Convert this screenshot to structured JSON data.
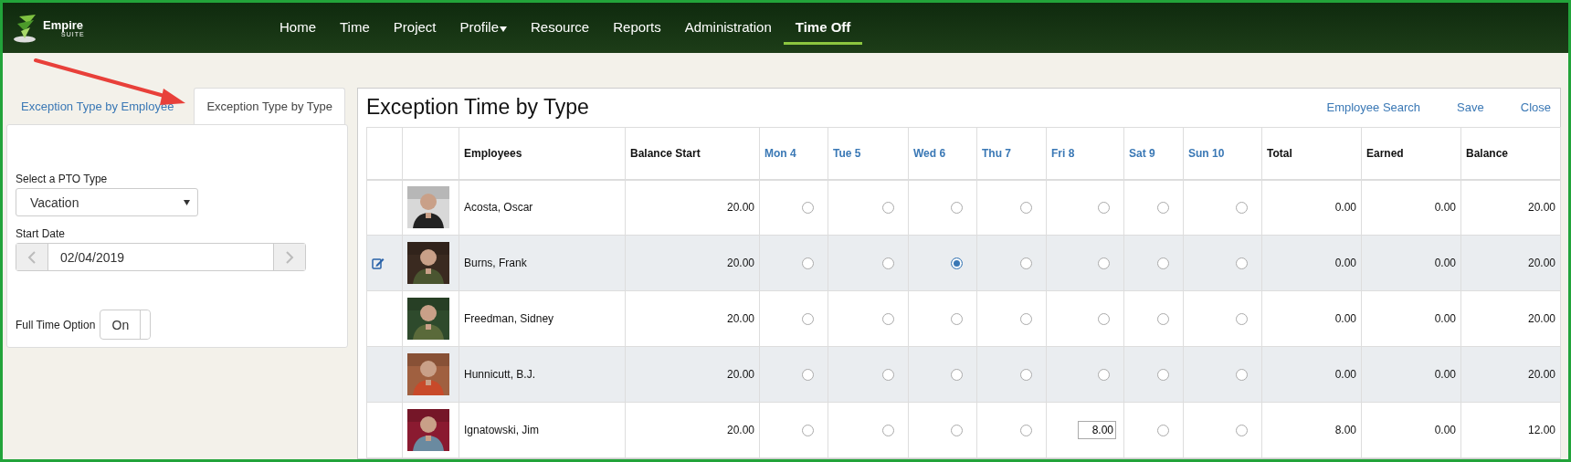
{
  "header": {
    "logo": {
      "name": "Empire",
      "tagline": "SUITE"
    },
    "nav": [
      {
        "label": "Home",
        "selected": false,
        "dropdown": false
      },
      {
        "label": "Time",
        "selected": false,
        "dropdown": false
      },
      {
        "label": "Project",
        "selected": false,
        "dropdown": false
      },
      {
        "label": "Profile",
        "selected": false,
        "dropdown": true
      },
      {
        "label": "Resource",
        "selected": false,
        "dropdown": false
      },
      {
        "label": "Reports",
        "selected": false,
        "dropdown": false
      },
      {
        "label": "Administration",
        "selected": false,
        "dropdown": false
      },
      {
        "label": "Time Off",
        "selected": true,
        "dropdown": false
      }
    ]
  },
  "sidebar": {
    "tabs": [
      {
        "label": "Exception Type by Employee",
        "selected": false
      },
      {
        "label": "Exception Type by Type",
        "selected": true
      }
    ],
    "pto_type": {
      "label": "Select a PTO Type",
      "value": "Vacation"
    },
    "start_date": {
      "label": "Start Date",
      "value": "02/04/2019"
    },
    "full_time": {
      "label": "Full Time Option",
      "value": "On",
      "on": true
    }
  },
  "main": {
    "title": "Exception Time by Type",
    "actions": [
      "Employee Search",
      "Save",
      "Close"
    ],
    "table": {
      "columns": [
        "Employees",
        "Balance Start",
        "Mon 4",
        "Tue 5",
        "Wed 6",
        "Thu 7",
        "Fri 8",
        "Sat 9",
        "Sun 10",
        "Total",
        "Earned",
        "Balance"
      ],
      "rows": [
        {
          "editing": false,
          "photo": {
            "kind": "picture"
          },
          "name": "Acosta, Oscar",
          "balance_start": "20.00",
          "days": [
            {
              "kind": "radio",
              "selected": false
            },
            {
              "kind": "radio",
              "selected": false
            },
            {
              "kind": "radio",
              "selected": false
            },
            {
              "kind": "radio",
              "selected": false
            },
            {
              "kind": "radio",
              "selected": false
            },
            {
              "kind": "radio",
              "selected": false
            },
            {
              "kind": "radio",
              "selected": false
            }
          ],
          "total": "0.00",
          "earned": "0.00",
          "balance": "20.00"
        },
        {
          "editing": true,
          "photo": {
            "kind": "picture"
          },
          "name": "Burns, Frank",
          "balance_start": "20.00",
          "days": [
            {
              "kind": "radio",
              "selected": false
            },
            {
              "kind": "radio",
              "selected": false
            },
            {
              "kind": "radio",
              "selected": true
            },
            {
              "kind": "radio",
              "selected": false
            },
            {
              "kind": "radio",
              "selected": false
            },
            {
              "kind": "radio",
              "selected": false
            },
            {
              "kind": "radio",
              "selected": false
            }
          ],
          "total": "0.00",
          "earned": "0.00",
          "balance": "20.00"
        },
        {
          "editing": false,
          "photo": {
            "kind": "picture"
          },
          "name": "Freedman, Sidney",
          "balance_start": "20.00",
          "days": [
            {
              "kind": "radio",
              "selected": false
            },
            {
              "kind": "radio",
              "selected": false
            },
            {
              "kind": "radio",
              "selected": false
            },
            {
              "kind": "radio",
              "selected": false
            },
            {
              "kind": "radio",
              "selected": false
            },
            {
              "kind": "radio",
              "selected": false
            },
            {
              "kind": "radio",
              "selected": false
            }
          ],
          "total": "0.00",
          "earned": "0.00",
          "balance": "20.00"
        },
        {
          "editing": false,
          "photo": {
            "kind": "picture"
          },
          "name": "Hunnicutt, B.J.",
          "balance_start": "20.00",
          "days": [
            {
              "kind": "radio",
              "selected": false
            },
            {
              "kind": "radio",
              "selected": false
            },
            {
              "kind": "radio",
              "selected": false
            },
            {
              "kind": "radio",
              "selected": false
            },
            {
              "kind": "radio",
              "selected": false
            },
            {
              "kind": "radio",
              "selected": false
            },
            {
              "kind": "radio",
              "selected": false
            }
          ],
          "total": "0.00",
          "earned": "0.00",
          "balance": "20.00"
        },
        {
          "editing": false,
          "photo": {
            "kind": "picture"
          },
          "name": "Ignatowski, Jim",
          "balance_start": "20.00",
          "days": [
            {
              "kind": "radio",
              "selected": false
            },
            {
              "kind": "radio",
              "selected": false
            },
            {
              "kind": "radio",
              "selected": false
            },
            {
              "kind": "radio",
              "selected": false
            },
            {
              "kind": "input",
              "value": "8.00"
            },
            {
              "kind": "radio",
              "selected": false
            },
            {
              "kind": "radio",
              "selected": false
            }
          ],
          "total": "8.00",
          "earned": "0.00",
          "balance": "12.00"
        }
      ]
    }
  }
}
